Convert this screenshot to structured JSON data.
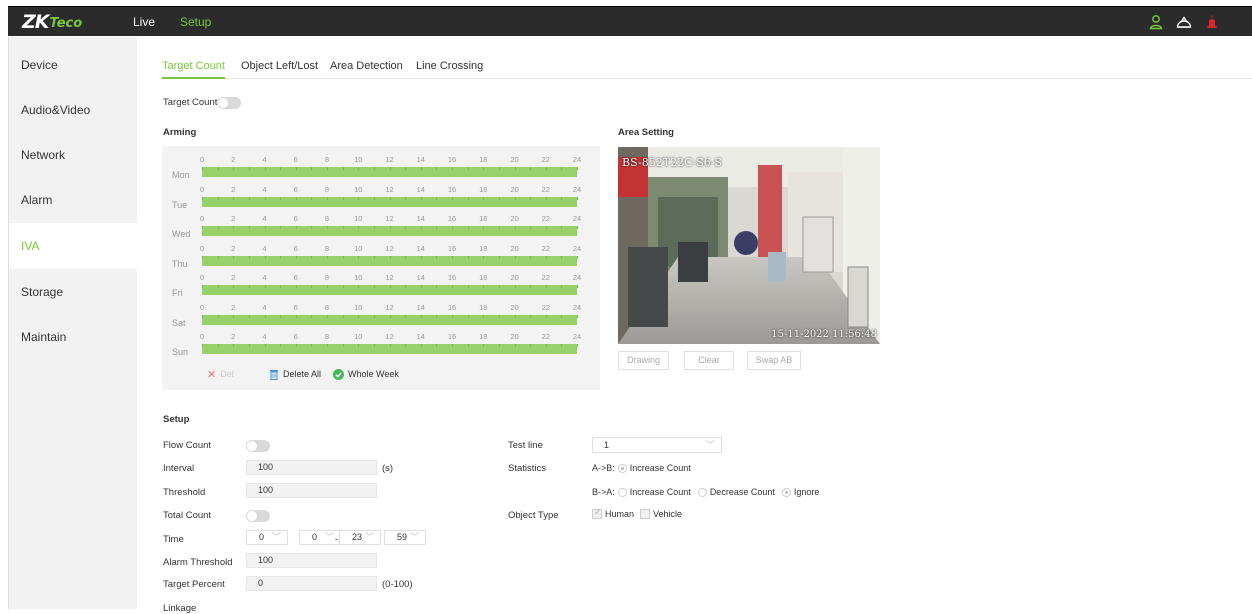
{
  "header": {
    "logo_main": "ZK",
    "logo_sub": "Teco",
    "nav": {
      "live": "Live",
      "setup": "Setup"
    }
  },
  "sidebar": {
    "items": [
      {
        "label": "Device"
      },
      {
        "label": "Audio&Video"
      },
      {
        "label": "Network"
      },
      {
        "label": "Alarm"
      },
      {
        "label": "IVA"
      },
      {
        "label": "Storage"
      },
      {
        "label": "Maintain"
      }
    ],
    "active": "IVA"
  },
  "tabs": [
    {
      "label": "Target Count"
    },
    {
      "label": "Object Left/Lost"
    },
    {
      "label": "Area Detection"
    },
    {
      "label": "Line Crossing"
    }
  ],
  "target_count": {
    "label": "Target Count",
    "enabled": false
  },
  "arming": {
    "title": "Arming",
    "days": [
      "Mon",
      "Tue",
      "Wed",
      "Thu",
      "Fri",
      "Sat",
      "Sun"
    ],
    "hours": [
      "0",
      "2",
      "4",
      "6",
      "8",
      "10",
      "12",
      "14",
      "16",
      "18",
      "20",
      "22",
      "24"
    ],
    "buttons": {
      "del": "Del",
      "delete_all": "Delete All",
      "whole_week": "Whole Week"
    },
    "bar_color": "#98d06a"
  },
  "area_setting": {
    "title": "Area Setting",
    "camera_name": "BS-852T22C-S6-S",
    "overlay_time": "15-11-2022 11:56:48",
    "buttons": {
      "drawing": "Drawing",
      "clear": "Clear",
      "swap": "Swap AB"
    }
  },
  "setup": {
    "title": "Setup",
    "flow_count": {
      "label": "Flow Count",
      "enabled": false
    },
    "interval": {
      "label": "Interval",
      "value": "100",
      "unit": "(s)"
    },
    "threshold": {
      "label": "Threshold",
      "value": "100"
    },
    "total_count": {
      "label": "Total Count",
      "enabled": false
    },
    "time": {
      "label": "Time",
      "start_h": "0",
      "start_m": "0",
      "sep": "-",
      "end_h": "23",
      "end_m": "59"
    },
    "alarm_threshold": {
      "label": "Alarm Threshold",
      "value": "100"
    },
    "target_percent": {
      "label": "Target Percent",
      "value": "0",
      "range": "(0-100)"
    },
    "linkage": {
      "label": "Linkage"
    },
    "test_line": {
      "label": "Test line",
      "value": "1"
    },
    "statistics": {
      "label": "Statistics",
      "ab_label": "A->B:",
      "ab_option": "Increase Count",
      "ba_label": "B->A:",
      "ba_options": [
        "Increase Count",
        "Decrease Count",
        "Ignore"
      ],
      "ba_selected": "Ignore"
    },
    "object_type": {
      "label": "Object Type",
      "options": [
        "Human",
        "Vehicle"
      ],
      "checked": [
        "Human"
      ]
    }
  },
  "colors": {
    "accent": "#78c83c",
    "topbar": "#2b2b2b",
    "sidebar": "#f2f2f2"
  }
}
